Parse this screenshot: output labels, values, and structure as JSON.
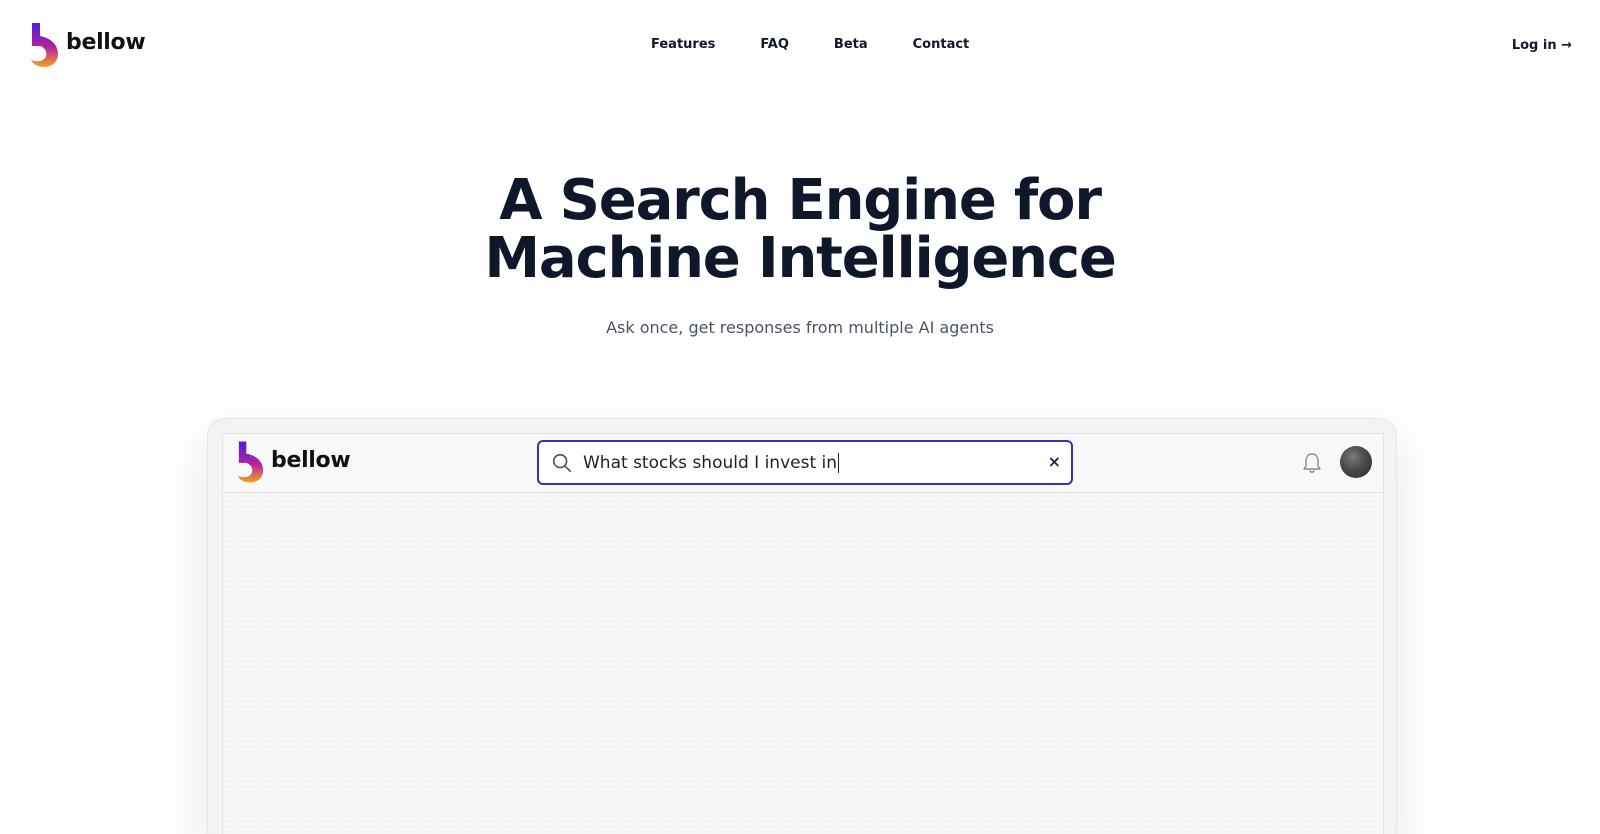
{
  "brand": {
    "name": "bellow"
  },
  "nav": {
    "items": [
      {
        "label": "Features"
      },
      {
        "label": "FAQ"
      },
      {
        "label": "Beta"
      },
      {
        "label": "Contact"
      }
    ],
    "login_label": "Log in →"
  },
  "hero": {
    "title_line1": "A Search Engine for",
    "title_line2": "Machine Intelligence",
    "subtitle": "Ask once, get responses from multiple AI agents"
  },
  "mockup": {
    "brand_name": "bellow",
    "search_value": "What stocks should I invest in",
    "clear_glyph": "×",
    "accent_color": "#3b2fb8"
  },
  "colors": {
    "logo_gradient": [
      "#4f1fd6",
      "#e0268a",
      "#f7a21b"
    ],
    "text_dark": "#0f172a"
  }
}
